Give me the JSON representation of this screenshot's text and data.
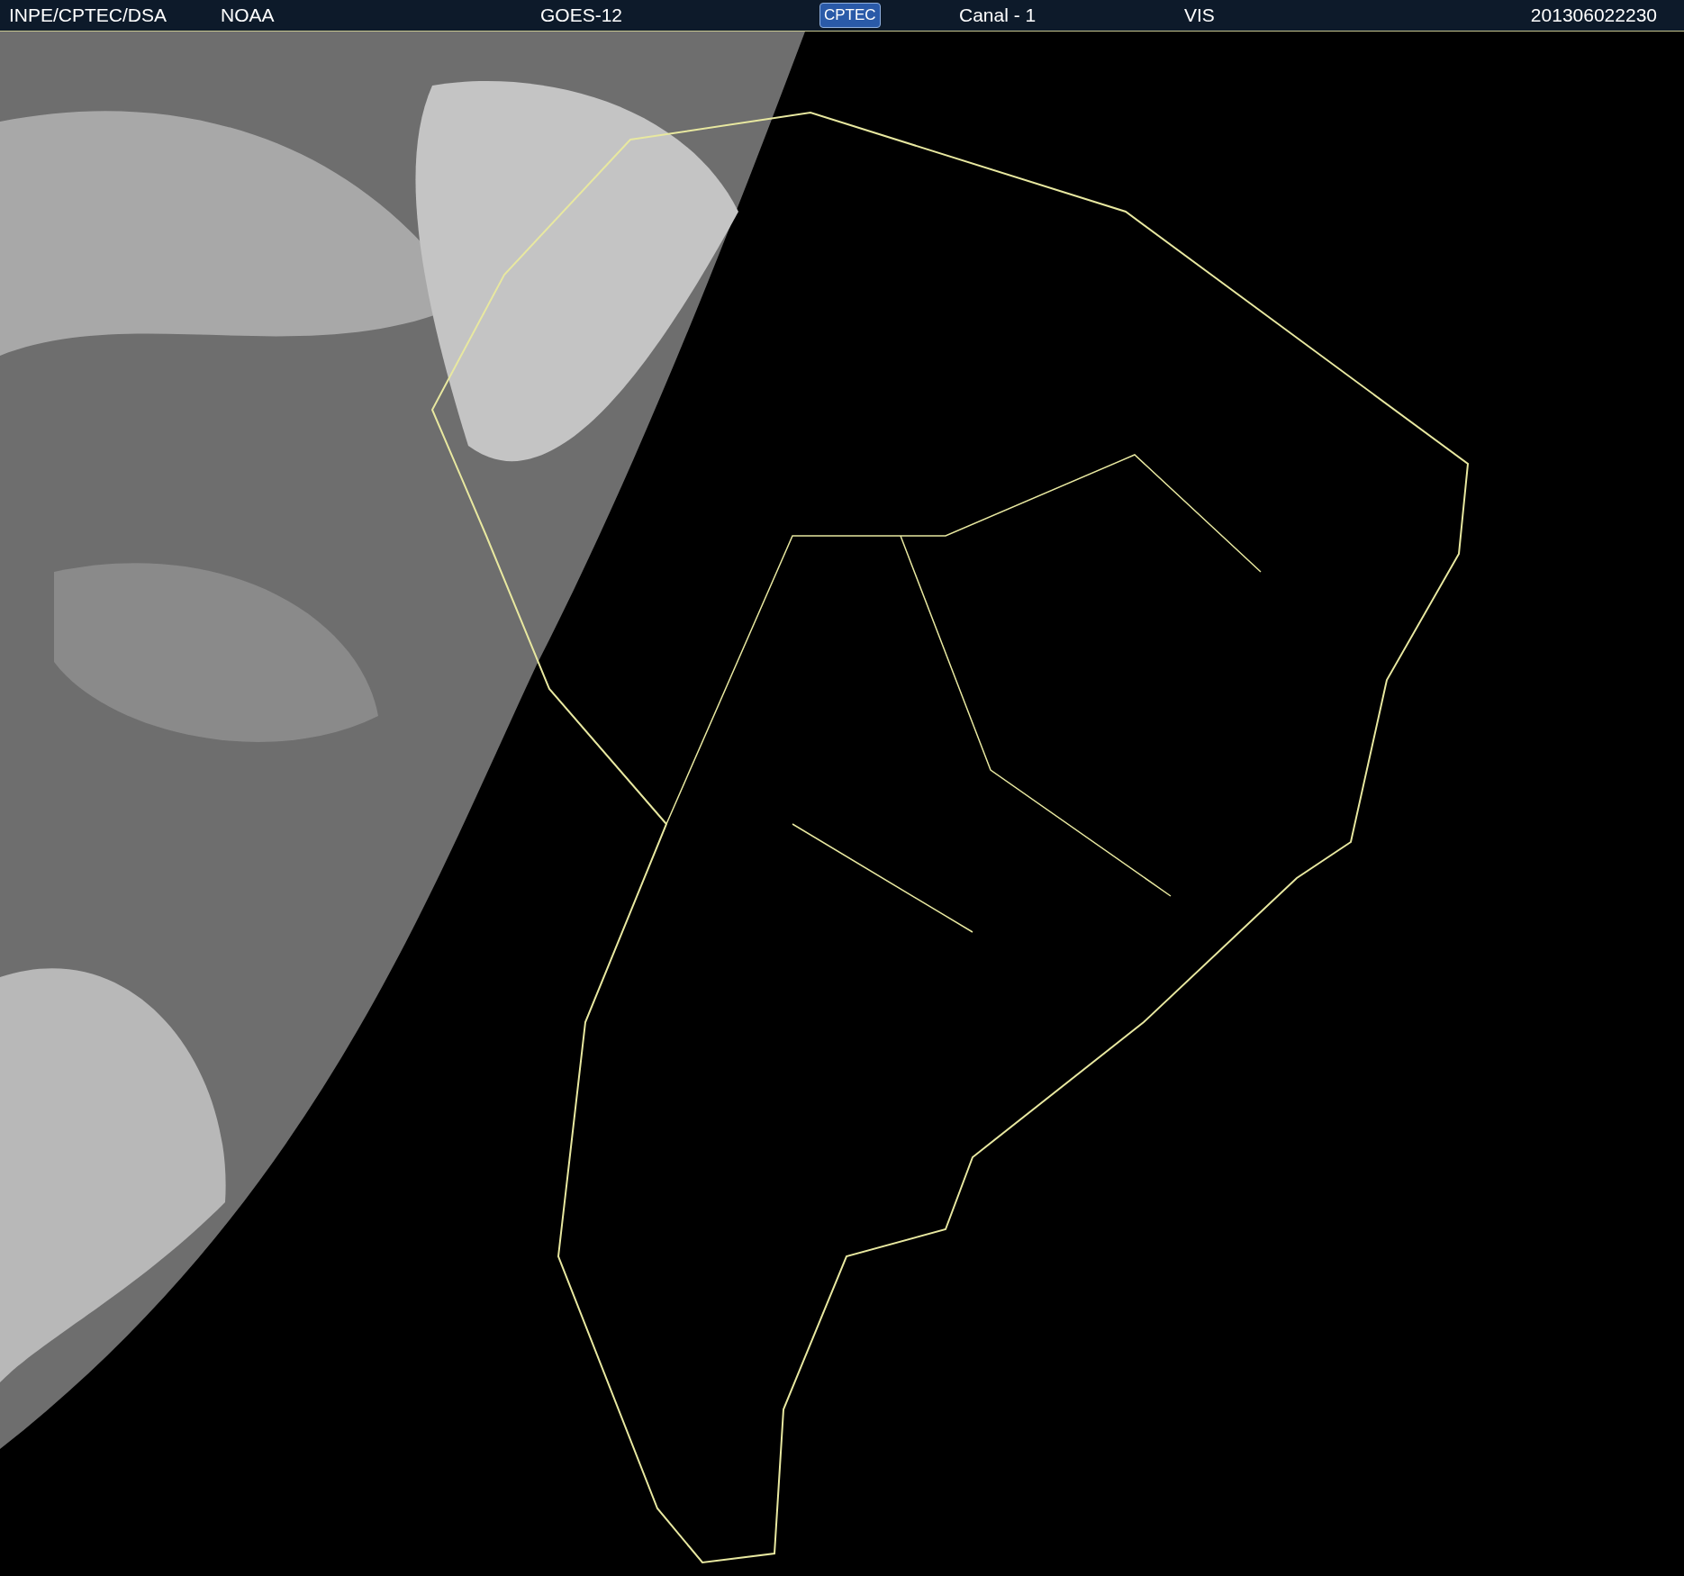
{
  "header": {
    "items": [
      {
        "kind": "text",
        "text": "INPE/CPTEC/DSA"
      },
      {
        "kind": "text",
        "text": "NOAA"
      },
      {
        "kind": "text",
        "text": "GOES-12"
      },
      {
        "kind": "logo",
        "text": "CPTEC"
      },
      {
        "kind": "text",
        "text": "Canal - 1"
      },
      {
        "kind": "text",
        "text": "VIS"
      },
      {
        "kind": "text",
        "text": "201306022230"
      }
    ]
  }
}
